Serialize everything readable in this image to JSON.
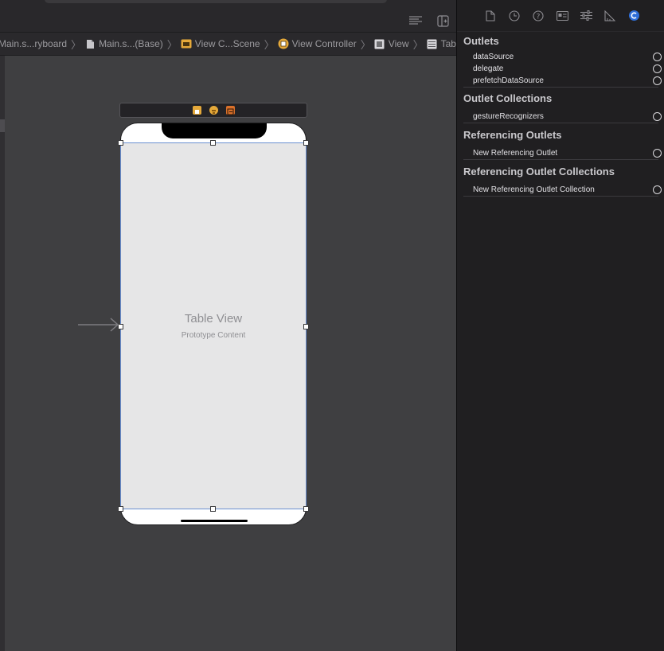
{
  "colors": {
    "canvas_bg": "#3f3f41",
    "inspector_bg": "#201f21",
    "selection_blue": "#6a8fd0",
    "active_tab": "#2f6ed8"
  },
  "editor_toolbar": {
    "icons": [
      "editor-options-icon",
      "add-editor-icon"
    ]
  },
  "breadcrumb": [
    {
      "label": "Main.s...ryboard",
      "icon": "storyboard-icon"
    },
    {
      "label": "Main.s...(Base)",
      "icon": "file-icon"
    },
    {
      "label": "View C...Scene",
      "icon": "scene-icon"
    },
    {
      "label": "View Controller",
      "icon": "view-controller-icon"
    },
    {
      "label": "View",
      "icon": "view-icon"
    },
    {
      "label": "Table View",
      "icon": "table-view-icon"
    }
  ],
  "canvas": {
    "table_view_title": "Table View",
    "table_view_subtitle": "Prototype Content",
    "dock_icons": [
      "view-controller-icon",
      "first-responder-icon",
      "exit-icon"
    ]
  },
  "inspector": {
    "tabs": [
      "file-inspector-icon",
      "history-icon",
      "quick-help-icon",
      "identity-icon",
      "attributes-icon",
      "size-icon",
      "connections-icon"
    ],
    "active_tab": "connections-icon",
    "sections": [
      {
        "title": "Outlets",
        "rows": [
          "dataSource",
          "delegate",
          "prefetchDataSource"
        ]
      },
      {
        "title": "Outlet Collections",
        "rows": [
          "gestureRecognizers"
        ]
      },
      {
        "title": "Referencing Outlets",
        "rows": [
          "New Referencing Outlet"
        ]
      },
      {
        "title": "Referencing Outlet Collections",
        "rows": [
          "New Referencing Outlet Collection"
        ]
      }
    ]
  }
}
